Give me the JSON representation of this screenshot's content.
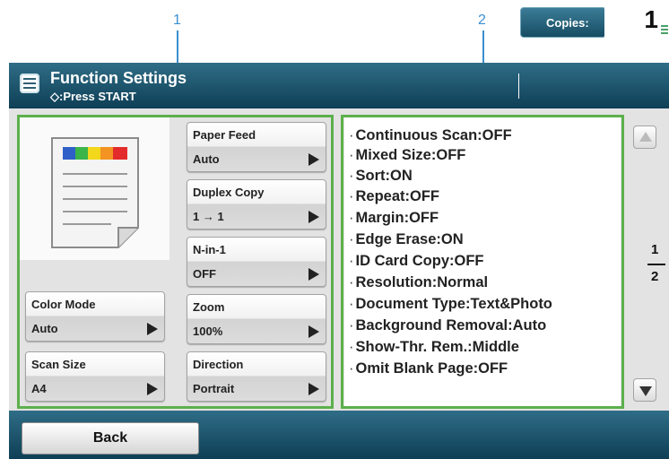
{
  "callouts": {
    "one": "1",
    "two": "2"
  },
  "header": {
    "title": "Function Settings",
    "subtitle": "◇:Press START",
    "copies_label": "Copies:",
    "copies_value": "1"
  },
  "left_column": {
    "color_mode": {
      "label": "Color Mode",
      "value": "Auto"
    },
    "scan_size": {
      "label": "Scan Size",
      "value": "A4"
    }
  },
  "middle_column": {
    "paper_feed": {
      "label": "Paper Feed",
      "value": "Auto"
    },
    "duplex_copy": {
      "label": "Duplex Copy",
      "value": "1 → 1"
    },
    "n_in_1": {
      "label": "N-in-1",
      "value": "OFF"
    },
    "zoom": {
      "label": "Zoom",
      "value": "100%"
    },
    "direction": {
      "label": "Direction",
      "value": "Portrait"
    }
  },
  "settings": [
    "Continuous Scan:OFF",
    "Mixed Size:OFF",
    "Sort:ON",
    "Repeat:OFF",
    "Margin:OFF",
    "Edge Erase:ON",
    "ID Card Copy:OFF",
    "Resolution:Normal",
    "Document Type:Text&Photo",
    "Background Removal:Auto",
    "Show-Thr. Rem.:Middle",
    "Omit Blank Page:OFF"
  ],
  "pager": {
    "current": "1",
    "total": "2"
  },
  "footer": {
    "back_label": "Back"
  },
  "colors": {
    "header_bg": "#1f5a73",
    "highlight_green": "#5cb04c",
    "callout_blue": "#3a8fd0"
  },
  "icons": {
    "menu": "menu-icon",
    "start": "start-diamond-icon",
    "keypad": "keypad-icon",
    "document": "document-preview-icon"
  }
}
